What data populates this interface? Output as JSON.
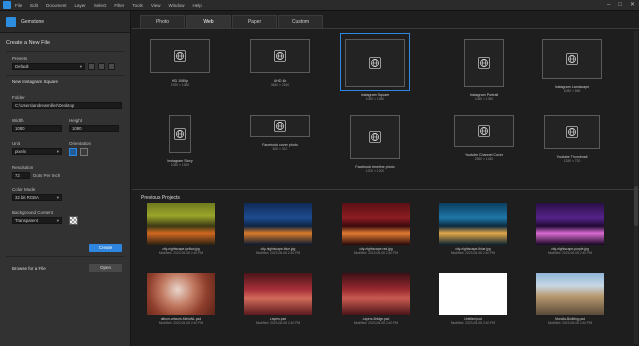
{
  "menubar": {
    "items": [
      "File",
      "Edit",
      "Document",
      "Layer",
      "Select",
      "Filter",
      "Tools",
      "View",
      "Window",
      "Help"
    ],
    "controls": [
      "–",
      "□",
      "✕"
    ]
  },
  "left": {
    "app_title": "Gemstone",
    "section_title": "Create a New File",
    "presets_label": "Presets",
    "preset_value": "Default",
    "preset_name": "New Instagram Square",
    "folder_label": "Folder",
    "folder_value": "C:\\Users\\andrewmiller\\Desktop",
    "width_label": "Width",
    "width_value": "1080",
    "height_label": "Height",
    "height_value": "1080",
    "unit_label": "Unit",
    "unit_value": "pixels",
    "orientation_label": "Orientation",
    "resolution_label": "Resolution",
    "resolution_value": "72",
    "resolution_unit": "Dots Per Inch",
    "color_mode_label": "Color Mode",
    "color_mode_value": "32 bit RGBA",
    "bg_label": "Background Content",
    "bg_value": "Transparent",
    "create_label": "Create",
    "browse_label": "Browse for a File",
    "open_label": "Open"
  },
  "tabs": [
    {
      "label": "Photo"
    },
    {
      "label": "Web"
    },
    {
      "label": "Paper"
    },
    {
      "label": "Custom"
    }
  ],
  "presets": [
    {
      "name": "HD 1080p",
      "size": "1920 × 1080"
    },
    {
      "name": "UHD 4k",
      "size": "3840 × 2160"
    },
    {
      "name": "Instagram Square",
      "size": "1080 × 1080"
    },
    {
      "name": "Instagram Portrait",
      "size": "1080 × 1350"
    },
    {
      "name": "Instagram Landscape",
      "size": "1080 × 566"
    },
    {
      "name": "Instagram Story",
      "size": "1080 × 1920"
    },
    {
      "name": "Facebook cover photo",
      "size": "820 × 312"
    },
    {
      "name": "Facebook timeline photo",
      "size": "1200 × 1200"
    },
    {
      "name": "Youtube Channel Cover",
      "size": "2560 × 1440"
    },
    {
      "name": "Youtube Thumbnail",
      "size": "1280 × 720"
    }
  ],
  "previous_title": "Previous Projects",
  "projects": [
    {
      "name": "city-nightscape-yellow.jpg",
      "date": "Modified: 2023-06-08 2:40 PM"
    },
    {
      "name": "city-nightscape-blue.jpg",
      "date": "Modified: 2023-06-08 2:40 PM"
    },
    {
      "name": "city-nightscape-red.jpg",
      "date": "Modified: 2023-06-08 2:40 PM"
    },
    {
      "name": "city-nightscape-lblue.jpg",
      "date": "Modified: 2023-06-08 2:40 PM"
    },
    {
      "name": "city-nightscape-purple.jpg",
      "date": "Modified: 2023-06-08 2:40 PM"
    },
    {
      "name": "album-artwork-MiniaNL.psd",
      "date": "Modified: 2023-06-08 2:40 PM"
    },
    {
      "name": "Layers.psd",
      "date": "Modified: 2023-06-08 2:40 PM"
    },
    {
      "name": "Layers-Bridge.psd",
      "date": "Modified: 2023-06-08 2:40 PM"
    },
    {
      "name": "Untitled.psd",
      "date": "Modified: 2023-06-08 2:40 PM"
    },
    {
      "name": "Mondia-Building.psd",
      "date": "Modified: 2023-06-08 2:40 PM"
    }
  ],
  "colors": {
    "accent": "#2e86de",
    "background": "#1e1e1e",
    "panel": "#323232"
  }
}
